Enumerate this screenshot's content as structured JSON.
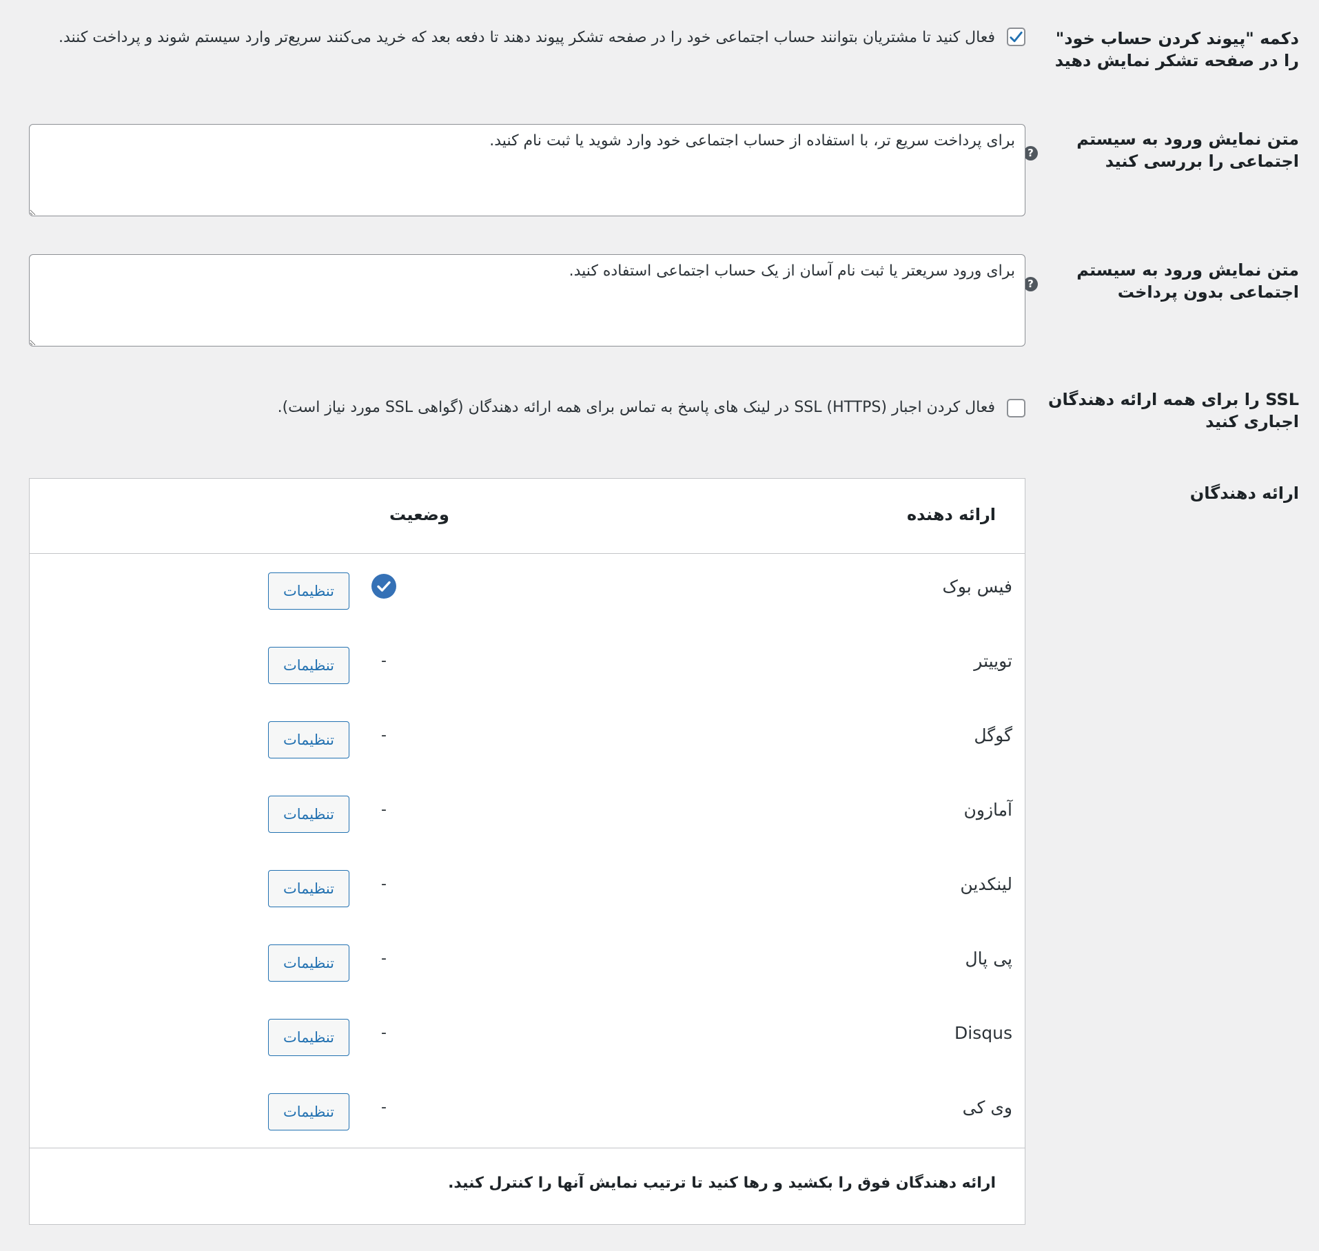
{
  "link_button": {
    "label": "دکمه \"پیوند کردن حساب خود\" را در صفحه تشکر نمایش دهید",
    "checked": true,
    "description": "فعال کنید تا مشتریان بتوانند حساب اجتماعی خود را در صفحه تشکر پیوند دهند تا دفعه بعد که خرید می‌کنند سریع‌تر وارد سیستم شوند و پرداخت کنند."
  },
  "checkout_text": {
    "label": "متن نمایش ورود به سیستم اجتماعی را بررسی کنید",
    "value": "برای پرداخت سریع تر، با استفاده از حساب اجتماعی خود وارد شوید یا ثبت نام کنید.",
    "help": "?"
  },
  "noncheckout_text": {
    "label": "متن نمایش ورود به سیستم اجتماعی بدون پرداخت",
    "value": "برای ورود سریعتر یا ثبت نام آسان از یک حساب اجتماعی استفاده کنید.",
    "help": "?"
  },
  "ssl": {
    "label": "SSL را برای همه ارائه دهندگان اجباری کنید",
    "checked": false,
    "description": "فعال کردن اجبار SSL (HTTPS) در لینک های پاسخ به تماس برای همه ارائه دهندگان (گواهی SSL مورد نیاز است)."
  },
  "providers": {
    "label": "ارائه دهندگان",
    "col_provider": "ارائه دهنده",
    "col_status": "وضعیت",
    "rows": [
      {
        "name": "فیس بوک",
        "status": "enabled",
        "button": "تنظیمات"
      },
      {
        "name": "توییتر",
        "status": "-",
        "button": "تنظیمات"
      },
      {
        "name": "گوگل",
        "status": "-",
        "button": "تنظیمات"
      },
      {
        "name": "آمازون",
        "status": "-",
        "button": "تنظیمات"
      },
      {
        "name": "لینکدین",
        "status": "-",
        "button": "تنظیمات"
      },
      {
        "name": "پی پال",
        "status": "-",
        "button": "تنظیمات"
      },
      {
        "name": "Disqus",
        "status": "-",
        "button": "تنظیمات"
      },
      {
        "name": "وی کی",
        "status": "-",
        "button": "تنظیمات"
      }
    ],
    "footer": "ارائه دهندگان فوق را بکشید و رها کنید تا ترتیب نمایش آنها را کنترل کنید."
  },
  "colors": {
    "accent": "#2271b1",
    "status_ok": "#3571b6"
  }
}
